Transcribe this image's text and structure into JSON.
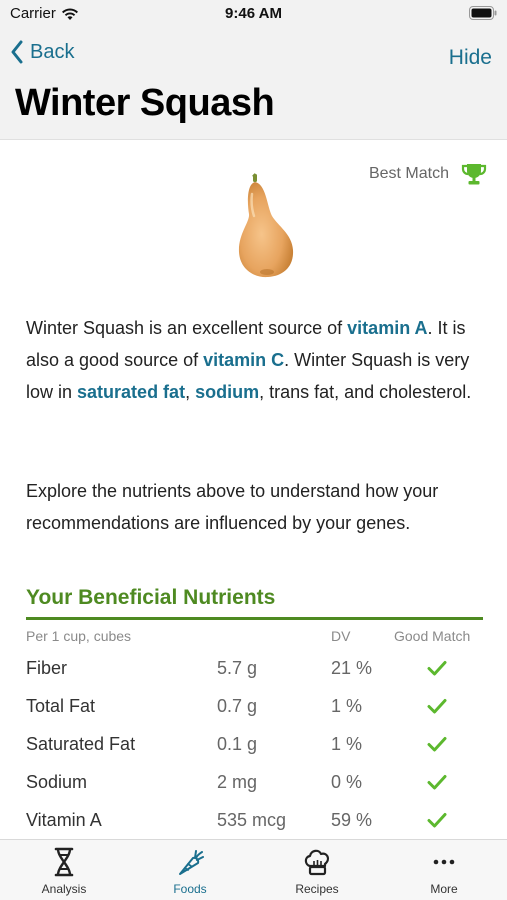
{
  "status_bar": {
    "carrier": "Carrier",
    "time": "9:46 AM"
  },
  "nav": {
    "back_label": "Back",
    "hide_label": "Hide",
    "title": "Winter Squash"
  },
  "best_match": {
    "label": "Best Match",
    "icon": "trophy-icon"
  },
  "description": {
    "p1": "Winter Squash is an excellent source of ",
    "link1": "vitamin A",
    "p2": ". It is also a good source of ",
    "link2": "vitamin C",
    "p3": ". Winter Squash is very low in ",
    "link3": "saturated fat",
    "p4": ", ",
    "link4": "sodium",
    "p5": ", trans fat, and cholesterol."
  },
  "explore_text": "Explore the nutrients above to understand how your recommendations are influenced by your genes.",
  "nutrients": {
    "title": "Your Beneficial Nutrients",
    "headers": {
      "serving": "Per 1 cup, cubes",
      "dv": "DV",
      "good_match": "Good Match"
    },
    "rows": [
      {
        "name": "Fiber",
        "amount": "5.7 g",
        "dv": "21 %"
      },
      {
        "name": "Total Fat",
        "amount": "0.7 g",
        "dv": "1 %"
      },
      {
        "name": "Saturated Fat",
        "amount": "0.1 g",
        "dv": "1 %"
      },
      {
        "name": "Sodium",
        "amount": "2 mg",
        "dv": "0 %"
      },
      {
        "name": "Vitamin A",
        "amount": "535 mcg",
        "dv": "59 %"
      }
    ]
  },
  "tabs": [
    {
      "label": "Analysis",
      "icon": "dna-icon",
      "active": false
    },
    {
      "label": "Foods",
      "icon": "carrot-icon",
      "active": true
    },
    {
      "label": "Recipes",
      "icon": "chef-hat-icon",
      "active": false
    },
    {
      "label": "More",
      "icon": "more-icon",
      "active": false
    }
  ],
  "colors": {
    "accent": "#1a6f8e",
    "green": "#4e8a21",
    "check": "#5cb82e"
  }
}
